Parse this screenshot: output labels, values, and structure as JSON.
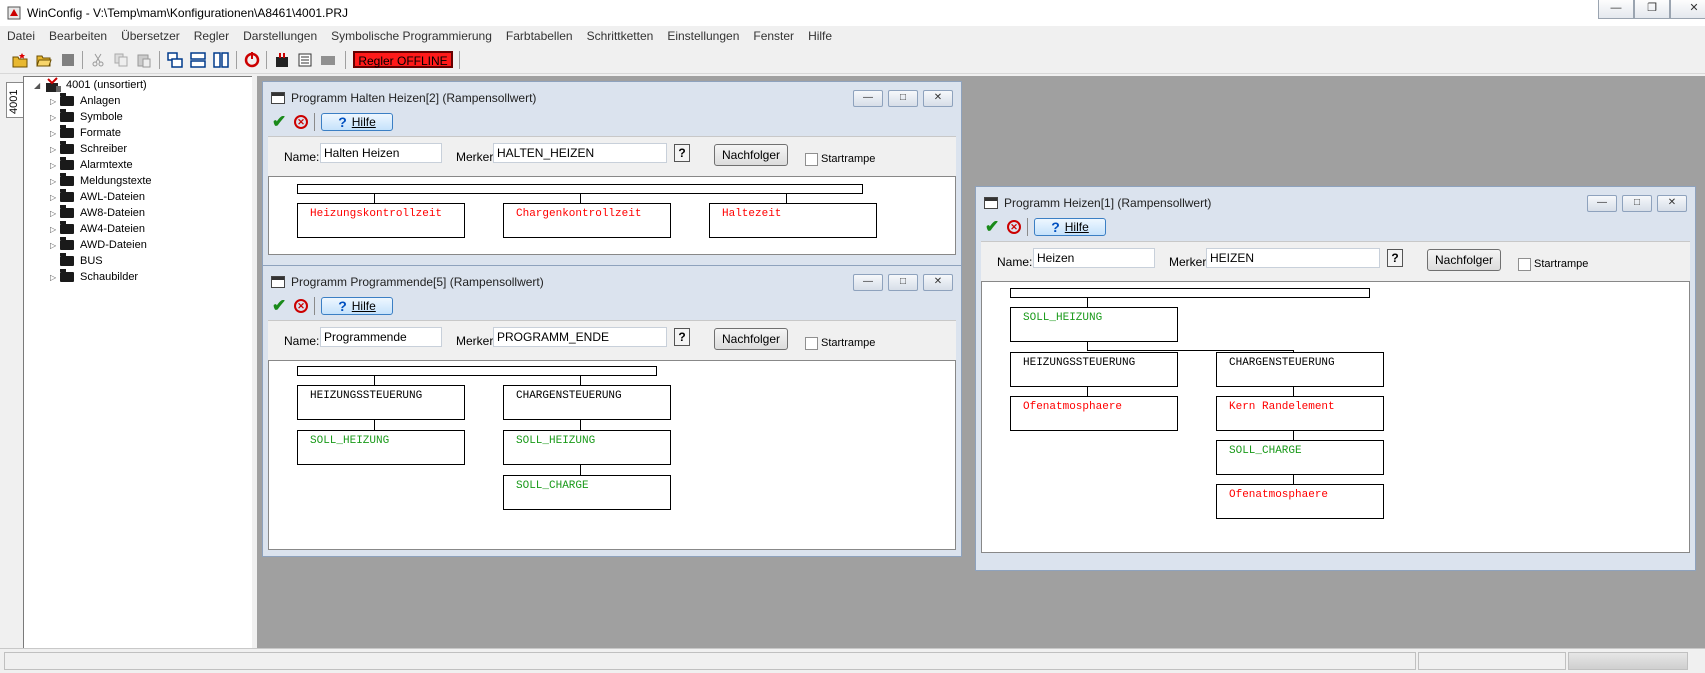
{
  "app": {
    "title": "WinConfig - V:\\Temp\\mam\\Konfigurationen\\A8461\\4001.PRJ"
  },
  "menu": [
    "Datei",
    "Bearbeiten",
    "Übersetzer",
    "Regler",
    "Darstellungen",
    "Symbolische Programmierung",
    "Farbtabellen",
    "Schrittketten",
    "Einstellungen",
    "Fenster",
    "Hilfe"
  ],
  "toolbar": {
    "status_label": "Regler OFFLINE"
  },
  "sidebar": {
    "tab_label": "4001",
    "root_label": "4001 (unsortiert)",
    "items": [
      {
        "label": "Anlagen",
        "expandable": true
      },
      {
        "label": "Symbole",
        "expandable": true
      },
      {
        "label": "Formate",
        "expandable": true
      },
      {
        "label": "Schreiber",
        "expandable": true
      },
      {
        "label": "Alarmtexte",
        "expandable": true
      },
      {
        "label": "Meldungstexte",
        "expandable": true
      },
      {
        "label": "AWL-Dateien",
        "expandable": true
      },
      {
        "label": "AW8-Dateien",
        "expandable": true
      },
      {
        "label": "AW4-Dateien",
        "expandable": true
      },
      {
        "label": "AWD-Dateien",
        "expandable": true
      },
      {
        "label": "BUS",
        "expandable": false
      },
      {
        "label": "Schaubilder",
        "expandable": true
      }
    ]
  },
  "common": {
    "help_label": "Hilfe",
    "name_label": "Name:",
    "merker_label": "Merker:",
    "question_label": "?",
    "nachfolger_label": "Nachfolger",
    "startrampe_label": "Startrampe"
  },
  "windows": {
    "halten": {
      "title": "Programm Halten Heizen[2] (Rampensollwert)",
      "name_value": "Halten Heizen",
      "merker_value": "HALTEN_HEIZEN",
      "boxes": [
        "Heizungskontrollzeit",
        "Chargenkontrollzeit",
        "Haltezeit"
      ]
    },
    "ende": {
      "title": "Programm Programmende[5] (Rampensollwert)",
      "name_value": "Programmende",
      "merker_value": "PROGRAMM_ENDE",
      "boxes": [
        "HEIZUNGSSTEUERUNG",
        "CHARGENSTEUERUNG",
        "SOLL_HEIZUNG",
        "SOLL_HEIZUNG",
        "SOLL_CHARGE"
      ]
    },
    "heizen": {
      "title": "Programm Heizen[1] (Rampensollwert)",
      "name_value": "Heizen",
      "merker_value": "HEIZEN",
      "boxes": [
        "SOLL_HEIZUNG",
        "HEIZUNGSSTEUERUNG",
        "CHARGENSTEUERUNG",
        "Ofenatmosphaere",
        "Kern Randelement",
        "SOLL_CHARGE",
        "Ofenatmosphaere"
      ]
    }
  },
  "colors": {
    "offline_bg": "#ff1a1a",
    "box_red": "#ff0000",
    "box_green": "#1a9a1a",
    "mdi_bg": "#a0a0a0"
  }
}
